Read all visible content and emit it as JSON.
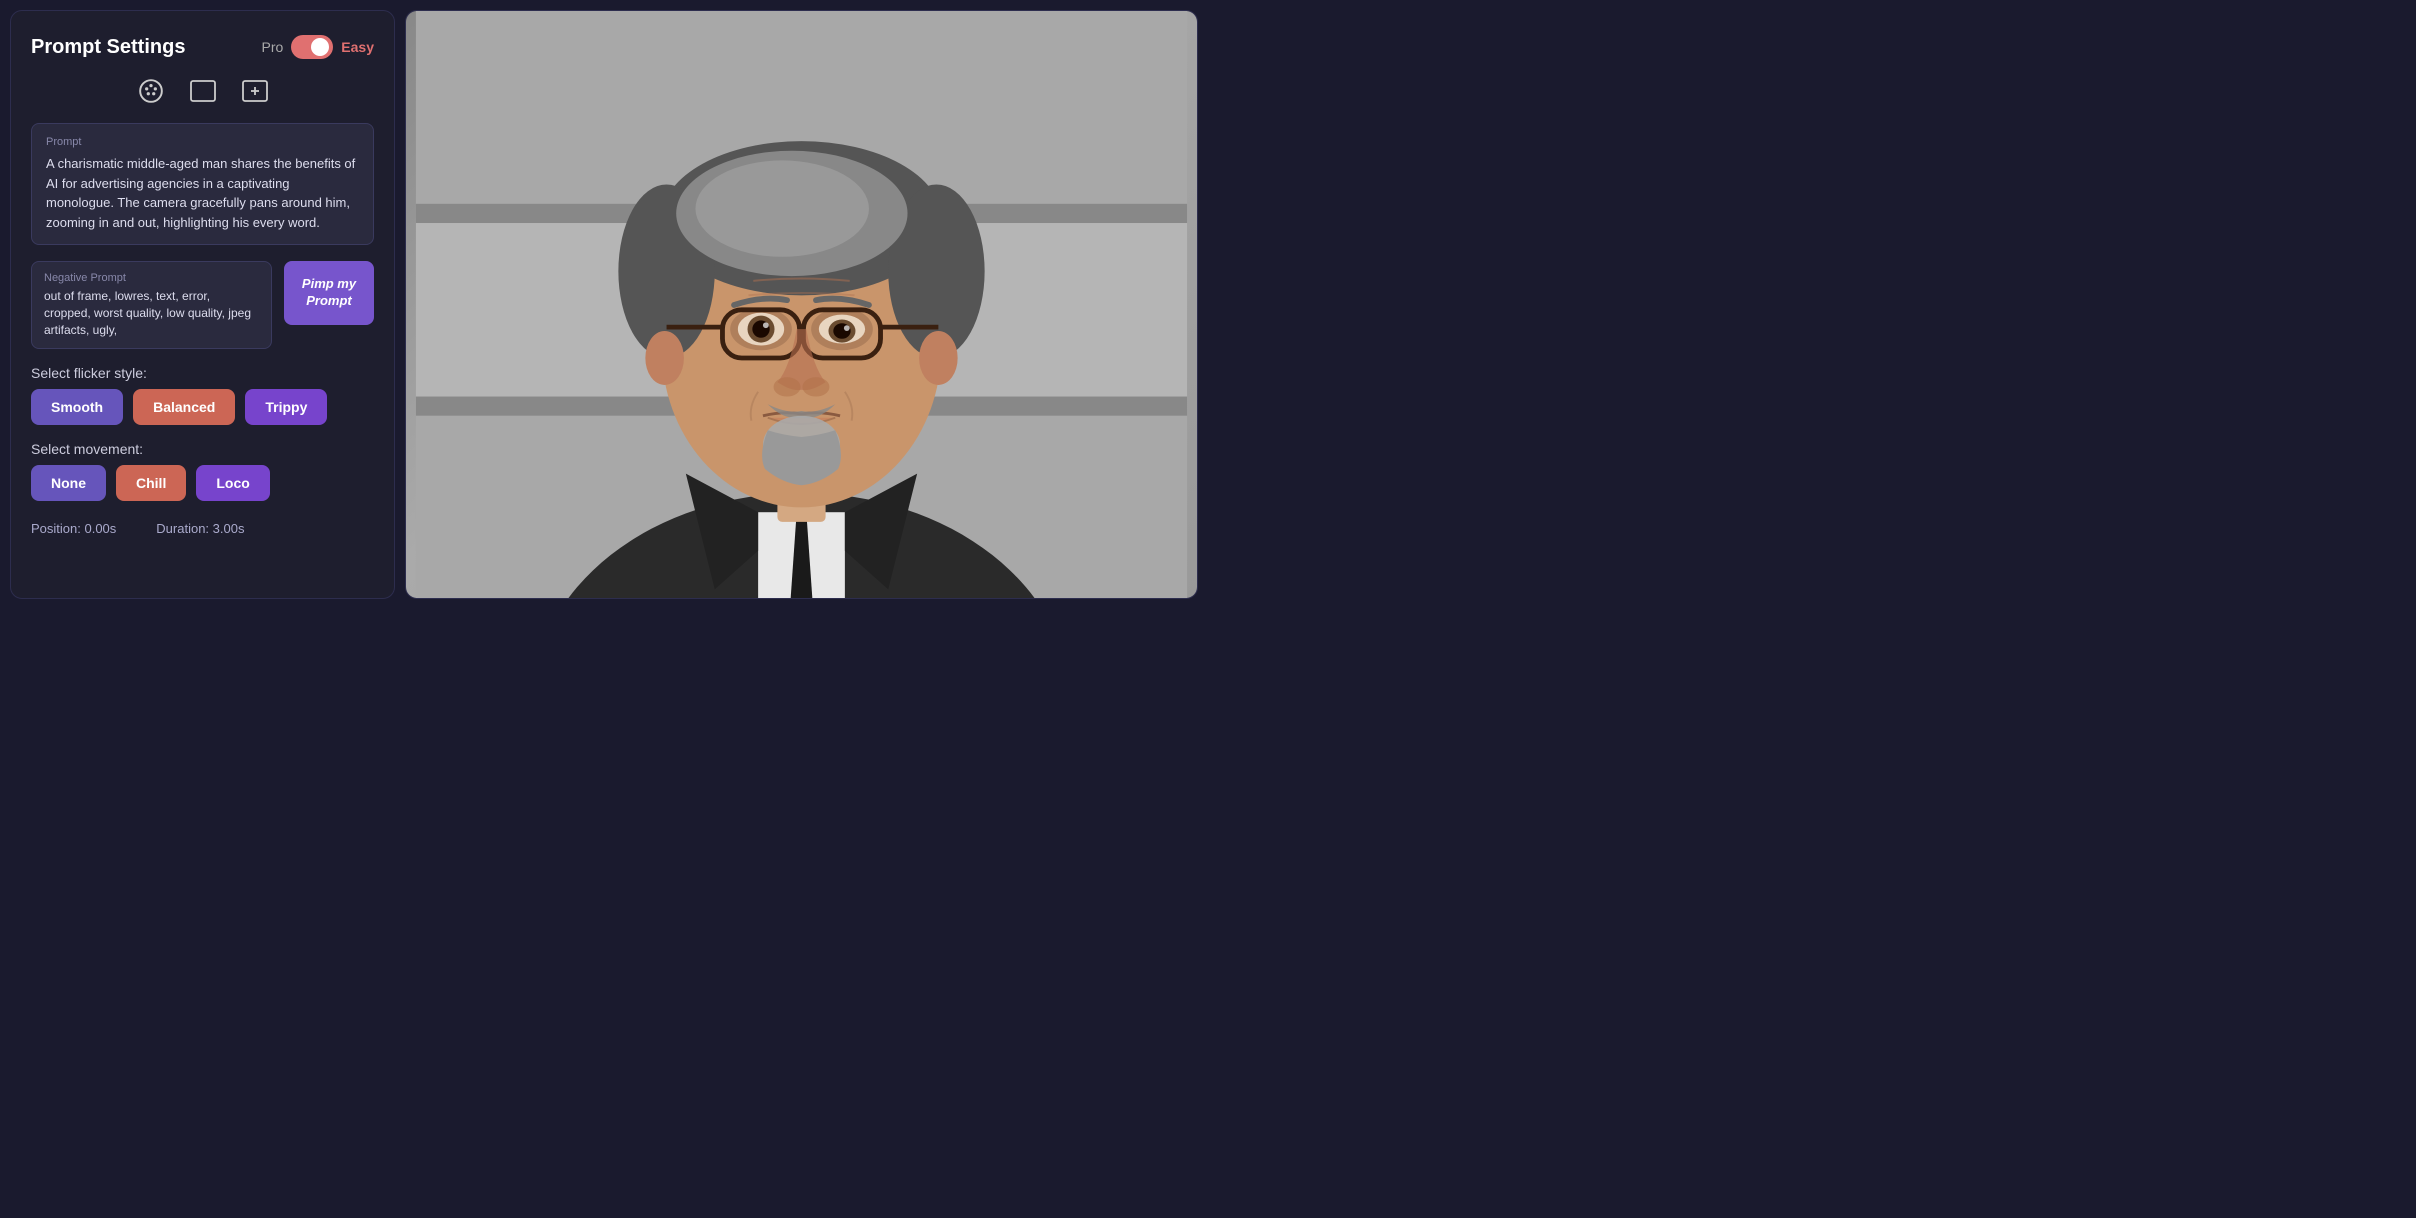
{
  "header": {
    "title": "Prompt Settings",
    "mode_pro": "Pro",
    "mode_easy": "Easy"
  },
  "icons": {
    "palette": "🎨",
    "frame": "⬜",
    "add_image": "🖼"
  },
  "prompt": {
    "label": "Prompt",
    "text": "A charismatic middle-aged man shares the benefits of AI for advertising agencies in a captivating monologue. The camera gracefully pans around him, zooming in and out, highlighting his every word."
  },
  "negative_prompt": {
    "label": "Negative Prompt",
    "text": "out of frame, lowres, text, error, cropped, worst quality, low quality, jpeg artifacts, ugly,"
  },
  "pimp_button": {
    "line1": "Pimp my",
    "line2": "Prompt"
  },
  "flicker_style": {
    "label": "Select flicker style:",
    "options": [
      {
        "id": "smooth",
        "label": "Smooth",
        "active": true,
        "variant": "purple"
      },
      {
        "id": "balanced",
        "label": "Balanced",
        "active": true,
        "variant": "salmon"
      },
      {
        "id": "trippy",
        "label": "Trippy",
        "active": false,
        "variant": "violet"
      }
    ]
  },
  "movement": {
    "label": "Select movement:",
    "options": [
      {
        "id": "none",
        "label": "None",
        "active": true,
        "variant": "purple"
      },
      {
        "id": "chill",
        "label": "Chill",
        "active": true,
        "variant": "salmon"
      },
      {
        "id": "loco",
        "label": "Loco",
        "active": false,
        "variant": "violet"
      }
    ]
  },
  "footer": {
    "position": "Position: 0.00s",
    "duration": "Duration: 3.00s"
  }
}
